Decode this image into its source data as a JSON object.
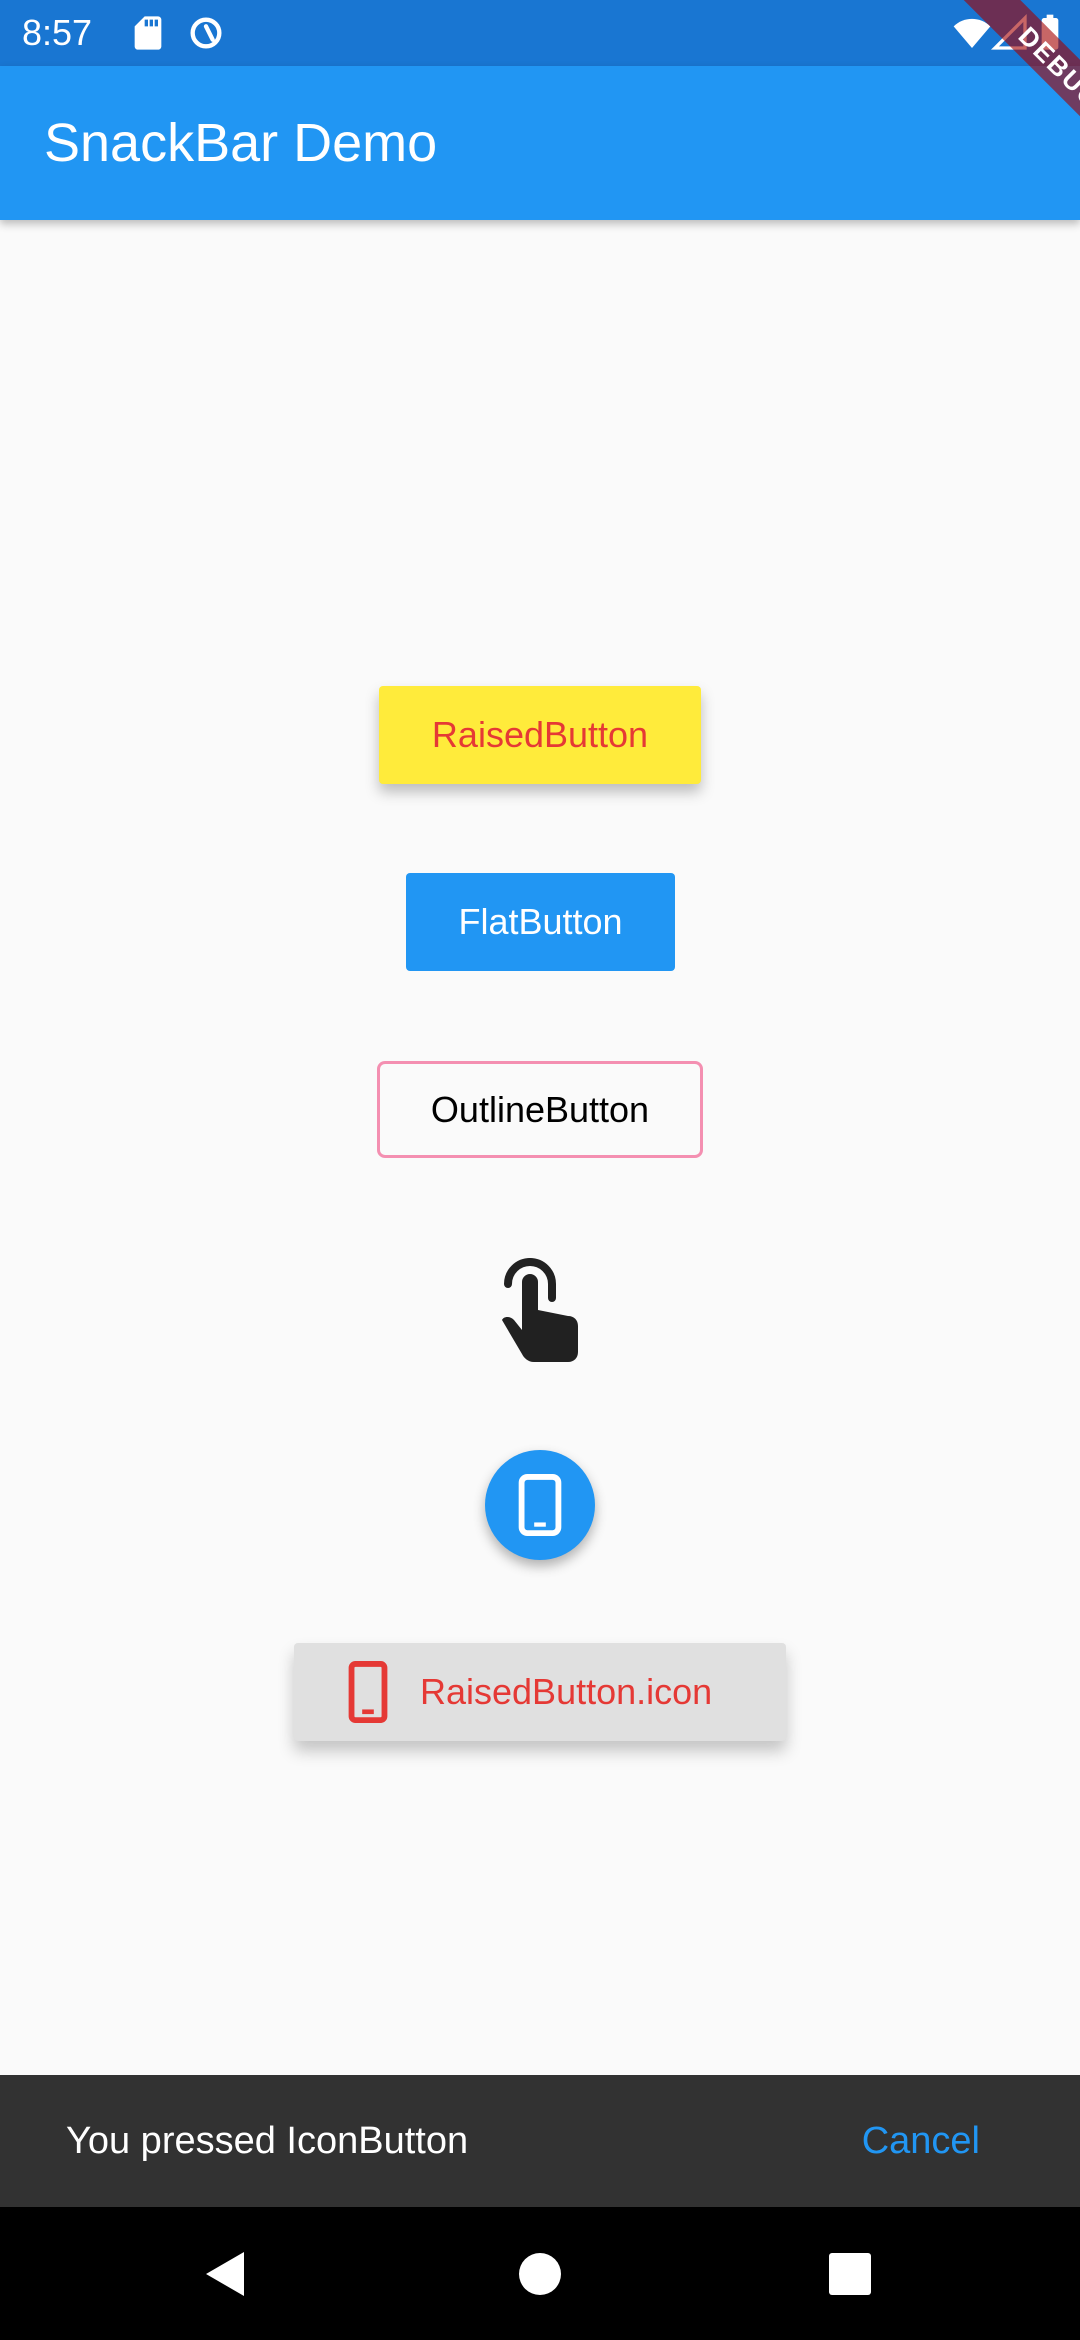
{
  "status_bar": {
    "time": "8:57",
    "icons": [
      "sd-card-icon",
      "sync-icon",
      "wifi-icon",
      "cell-signal-icon",
      "battery-icon"
    ]
  },
  "app_bar": {
    "title": "SnackBar Demo"
  },
  "debug_banner": {
    "label": "DEBUG"
  },
  "buttons": {
    "raised": {
      "label": "RaisedButton"
    },
    "flat": {
      "label": "FlatButton"
    },
    "outline": {
      "label": "OutlineButton"
    },
    "icon_button": {
      "icon": "touch-app-icon"
    },
    "fab": {
      "icon": "smartphone-icon"
    },
    "raised_icon": {
      "label": "RaisedButton.icon",
      "icon": "smartphone-icon"
    }
  },
  "snackbar": {
    "message": "You pressed IconButton",
    "action": "Cancel"
  },
  "nav_bar": {
    "icons": [
      "back-icon",
      "home-icon",
      "recents-icon"
    ]
  },
  "colors": {
    "status_bar": "#1976d2",
    "primary": "#2196f3",
    "yellow": "#ffeb3b",
    "red": "#e53935",
    "pink_border": "#f48fb1",
    "snackbar": "#323232",
    "background": "#fafafa"
  }
}
